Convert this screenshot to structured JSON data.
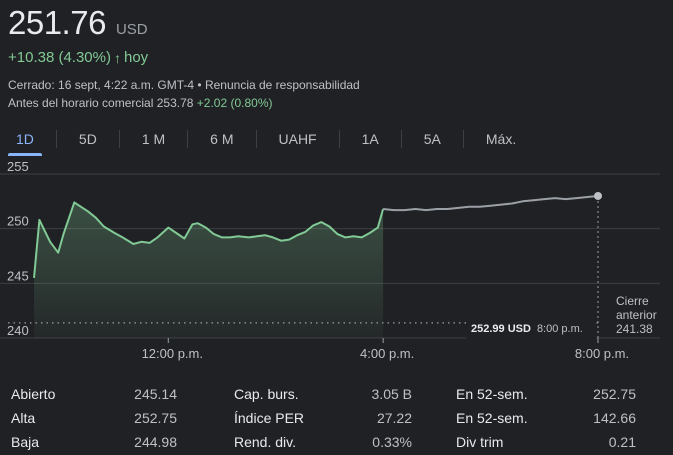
{
  "header": {
    "price": "251.76",
    "currency": "USD",
    "change": "+10.38 (4.30%)",
    "arrow_icon": "arrow-up-icon",
    "change_period": "hoy",
    "closed_text": "Cerrado: 16 sept, 4:22 a.m. GMT-4 • Renuncia de responsabilidad",
    "premarket_label": "Antes del horario comercial 253.78",
    "premarket_change": "+2.02 (0.80%)"
  },
  "tabs": [
    {
      "label": "1D",
      "active": true
    },
    {
      "label": "5D"
    },
    {
      "label": "1 M"
    },
    {
      "label": "6 M"
    },
    {
      "label": "UAHF"
    },
    {
      "label": "1A"
    },
    {
      "label": "5A"
    },
    {
      "label": "Máx."
    }
  ],
  "chart_data": {
    "type": "line",
    "y_ticks": [
      "255",
      "250",
      "245",
      "240"
    ],
    "ylim": [
      240,
      255
    ],
    "x_ticks": [
      "12:00 p.m.",
      "4:00 p.m.",
      "8:00 p.m."
    ],
    "previous_close_label": "Cierre anterior",
    "previous_close_value": "241.38",
    "previous_close": 241.38,
    "tooltip_price": "252.99 USD",
    "tooltip_time": "8:00 p.m.",
    "colors": {
      "regular": "#81c995",
      "extended": "#9aa0a6",
      "grid": "#3c4043"
    },
    "x_range": [
      9.5,
      20.0
    ],
    "series": [
      {
        "session": "regular",
        "x": [
          9.5,
          9.6,
          9.8,
          9.95,
          10.05,
          10.25,
          10.5,
          10.65,
          10.8,
          11.0,
          11.15,
          11.35,
          11.5,
          11.65,
          11.8,
          12.0,
          12.15,
          12.3,
          12.45,
          12.55,
          12.7,
          12.85,
          13.0,
          13.15,
          13.3,
          13.5,
          13.65,
          13.8,
          13.95,
          14.1,
          14.25,
          14.4,
          14.55,
          14.7,
          14.85,
          15.0,
          15.15,
          15.3,
          15.45,
          15.6,
          15.75,
          15.9,
          16.0
        ],
        "y": [
          245.5,
          250.8,
          248.8,
          247.8,
          249.5,
          252.4,
          251.6,
          251.0,
          250.2,
          249.6,
          249.2,
          248.6,
          248.8,
          248.7,
          249.2,
          250.1,
          249.6,
          249.1,
          250.4,
          250.5,
          250.1,
          249.5,
          249.2,
          249.2,
          249.3,
          249.2,
          249.3,
          249.4,
          249.2,
          248.9,
          249.0,
          249.4,
          249.7,
          250.3,
          250.6,
          250.2,
          249.5,
          249.2,
          249.3,
          249.2,
          249.6,
          250.1,
          251.8
        ]
      },
      {
        "session": "extended",
        "x": [
          16.0,
          16.2,
          16.4,
          16.6,
          16.8,
          17.0,
          17.2,
          17.4,
          17.6,
          17.8,
          18.0,
          18.2,
          18.4,
          18.6,
          18.8,
          19.0,
          19.2,
          19.4,
          19.6,
          19.8,
          20.0
        ],
        "y": [
          251.8,
          251.7,
          251.7,
          251.8,
          251.7,
          251.8,
          251.8,
          251.9,
          252.0,
          252.0,
          252.1,
          252.2,
          252.3,
          252.5,
          252.6,
          252.7,
          252.8,
          252.7,
          252.8,
          252.9,
          252.99
        ]
      }
    ]
  },
  "stats": {
    "col1": [
      {
        "label": "Abierto",
        "value": "245.14"
      },
      {
        "label": "Alta",
        "value": "252.75"
      },
      {
        "label": "Baja",
        "value": "244.98"
      }
    ],
    "col2": [
      {
        "label": "Cap. burs.",
        "value": "3.05 B"
      },
      {
        "label": "Índice PER",
        "value": "27.22"
      },
      {
        "label": "Rend. div.",
        "value": "0.33%"
      }
    ],
    "col3": [
      {
        "label": "En 52-sem.",
        "value": "252.75"
      },
      {
        "label": "En 52-sem.",
        "value": "142.66"
      },
      {
        "label": "Div trim",
        "value": "0.21"
      }
    ]
  }
}
